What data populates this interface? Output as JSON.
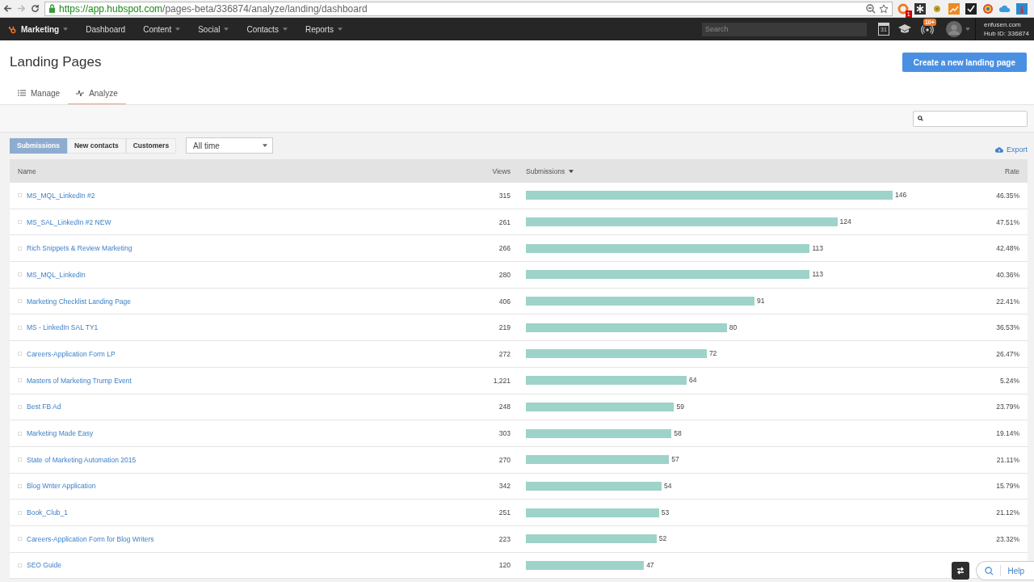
{
  "browser": {
    "url_host": "https://app.hubspot.com",
    "url_path": "/pages-beta/336874/analyze/landing/dashboard",
    "extension_badge": "1"
  },
  "nav": {
    "items": [
      {
        "label": "Marketing",
        "dropdown": true,
        "selected": true
      },
      {
        "label": "Dashboard",
        "dropdown": false,
        "selected": false
      },
      {
        "label": "Content",
        "dropdown": true,
        "selected": false
      },
      {
        "label": "Social",
        "dropdown": true,
        "selected": false
      },
      {
        "label": "Contacts",
        "dropdown": true,
        "selected": false
      },
      {
        "label": "Reports",
        "dropdown": true,
        "selected": false
      }
    ],
    "search": {
      "placeholder": "Search"
    },
    "calendar_day": "31",
    "notifications": "10+",
    "account": "enfusen.com",
    "hub_id": "Hub ID: 336874"
  },
  "page": {
    "title": "Landing Pages",
    "create_button": "Create a new landing page"
  },
  "tabs": [
    {
      "label": "Manage",
      "selected": false
    },
    {
      "label": "Analyze",
      "selected": true
    }
  ],
  "metric_buttons": [
    {
      "label": "Submissions",
      "selected": true
    },
    {
      "label": "New contacts",
      "selected": false
    },
    {
      "label": "Customers",
      "selected": false
    }
  ],
  "range_select": {
    "value": "All time"
  },
  "export": "Export",
  "table": {
    "columns": [
      "Name",
      "Views",
      "Submissions",
      "Rate"
    ],
    "rows": [
      {
        "name": "MS_MQL_LinkedIn #2",
        "views": "315",
        "submissions": "146",
        "rate": "46.35%"
      },
      {
        "name": "MS_SAL_LinkedIn #2 NEW",
        "views": "261",
        "submissions": "124",
        "rate": "47.51%"
      },
      {
        "name": "Rich Snippets & Review Marketing",
        "views": "266",
        "submissions": "113",
        "rate": "42.48%"
      },
      {
        "name": "MS_MQL_LinkedIn",
        "views": "280",
        "submissions": "113",
        "rate": "40.36%"
      },
      {
        "name": "Marketing Checklist Landing Page",
        "views": "406",
        "submissions": "91",
        "rate": "22.41%"
      },
      {
        "name": "MS - LinkedIn SAL TY1",
        "views": "219",
        "submissions": "80",
        "rate": "36.53%"
      },
      {
        "name": "Careers-Application Form LP",
        "views": "272",
        "submissions": "72",
        "rate": "26.47%"
      },
      {
        "name": "Masters of Marketing Trump Event",
        "views": "1,221",
        "submissions": "64",
        "rate": "5.24%"
      },
      {
        "name": "Best FB Ad",
        "views": "248",
        "submissions": "59",
        "rate": "23.79%"
      },
      {
        "name": "Marketing Made Easy",
        "views": "303",
        "submissions": "58",
        "rate": "19.14%"
      },
      {
        "name": "State of Marketing Automation 2015",
        "views": "270",
        "submissions": "57",
        "rate": "21.11%"
      },
      {
        "name": "Blog Writer Application",
        "views": "342",
        "submissions": "54",
        "rate": "15.79%"
      },
      {
        "name": "Book_Club_1",
        "views": "251",
        "submissions": "53",
        "rate": "21.12%"
      },
      {
        "name": "Careers-Application Form for Blog Writers",
        "views": "223",
        "submissions": "52",
        "rate": "23.32%"
      },
      {
        "name": "SEO Guide",
        "views": "120",
        "submissions": "47"
      }
    ]
  },
  "help": "Help"
}
